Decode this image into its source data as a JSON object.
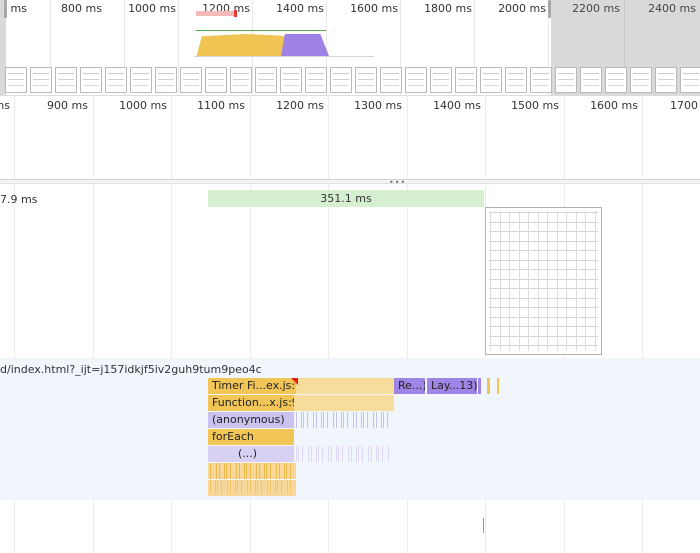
{
  "overview": {
    "ticks": [
      "ms",
      "800 ms",
      "1000 ms",
      "1200 ms",
      "1400 ms",
      "1600 ms",
      "1800 ms",
      "2000 ms",
      "2200 ms",
      "2400 ms"
    ]
  },
  "ruler": {
    "ticks": [
      "ms",
      "900 ms",
      "1000 ms",
      "1100 ms",
      "1200 ms",
      "1300 ms",
      "1400 ms",
      "1500 ms",
      "1600 ms",
      "1700"
    ]
  },
  "frames": {
    "left_label": "7.9 ms",
    "frame_duration": "351.1 ms"
  },
  "main_thread": {
    "url": "d/index.html?_ijt=j157idkjf5iv2guh9tum9peo4c",
    "events": {
      "timer_fired": "Timer Fi...ex.js:9)",
      "recalc_style": "Re...)",
      "layout": "Lay...13)",
      "function_call": "Function...x.js:9)",
      "anonymous": "(anonymous)",
      "for_each": "forEach",
      "ellipsis": "(...)"
    }
  },
  "colors": {
    "scripting": "#f2c557",
    "rendering": "#9f85e6",
    "frame": "#d7efd1",
    "main_band": "#f1f6fd"
  }
}
